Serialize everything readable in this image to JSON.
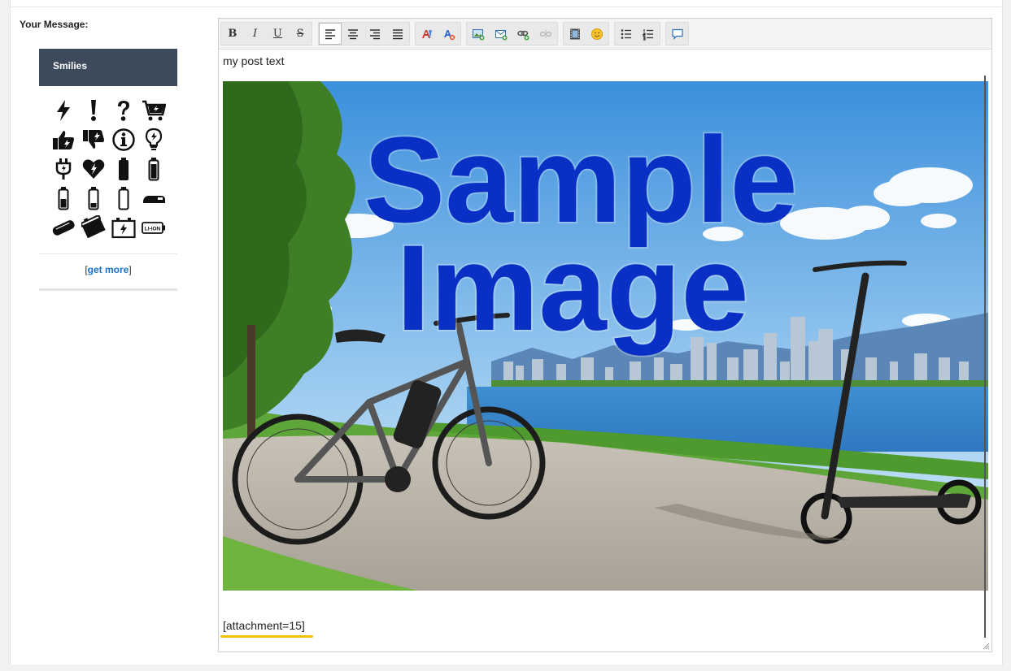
{
  "form": {
    "message_label": "Your Message:"
  },
  "smilies": {
    "title": "Smilies",
    "icons": [
      "lightning-icon",
      "exclamation-icon",
      "question-icon",
      "cart-charge-icon",
      "thumbs-up-charge-icon",
      "thumbs-down-charge-icon",
      "info-icon",
      "bulb-icon",
      "plug-icon",
      "heart-charge-icon",
      "battery-full-icon",
      "battery-high-icon",
      "battery-half-icon",
      "battery-low-icon",
      "battery-empty-icon",
      "battery-side-icon",
      "battery-tilted-icon",
      "battery-box-icon",
      "car-battery-icon",
      "li-ion-battery-icon"
    ],
    "get_more_open": "[",
    "get_more_label": "get more",
    "get_more_close": "]",
    "liion_label": "LI-ION"
  },
  "toolbar": {
    "bold": "B",
    "italic": "I",
    "underline": "U",
    "strike": "S"
  },
  "editor": {
    "text": "my post text",
    "image_headline_1": "Sample",
    "image_headline_2": "Image",
    "attachment_tag": "[attachment=15]"
  }
}
